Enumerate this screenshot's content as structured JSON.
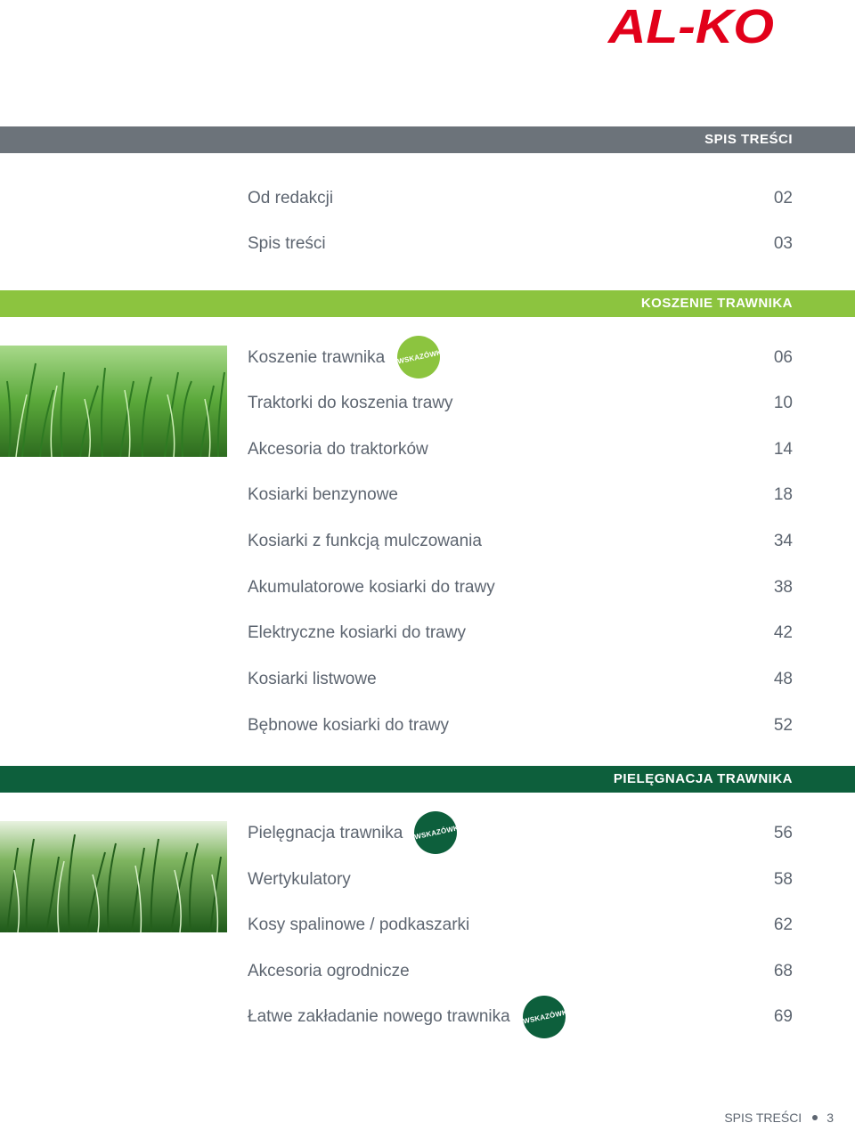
{
  "logo": {
    "text": "AL-KO",
    "color": "#e2001a"
  },
  "header": {
    "title": "SPIS TREŚCI"
  },
  "intro": [
    {
      "title": "Od redakcji",
      "page": "02"
    },
    {
      "title": "Spis treści",
      "page": "03"
    }
  ],
  "section1": {
    "title": "KOSZENIE TRAWNIKA",
    "color": "#8cc43f",
    "badge": "WSKAZÓWKI",
    "items": [
      {
        "title": "Koszenie trawnika",
        "page": "06"
      },
      {
        "title": "Traktorki do koszenia trawy",
        "page": "10"
      },
      {
        "title": "Akcesoria do traktorków",
        "page": "14"
      },
      {
        "title": "Kosiarki benzynowe",
        "page": "18"
      },
      {
        "title": "Kosiarki z funkcją mulczowania",
        "page": "34"
      },
      {
        "title": "Akumulatorowe kosiarki do trawy",
        "page": "38"
      },
      {
        "title": "Elektryczne kosiarki do trawy",
        "page": "42"
      },
      {
        "title": "Kosiarki listwowe",
        "page": "48"
      },
      {
        "title": "Bębnowe kosiarki do trawy",
        "page": "52"
      }
    ]
  },
  "section2": {
    "title": "PIELĘGNACJA TRAWNIKA",
    "color": "#0d5f3c",
    "badge": "WSKAZÓWKI",
    "badge2": "WSKAZÓWKI",
    "items": [
      {
        "title": "Pielęgnacja trawnika",
        "page": "56"
      },
      {
        "title": "Wertykulatory",
        "page": "58"
      },
      {
        "title": "Kosy spalinowe / podkaszarki",
        "page": "62"
      },
      {
        "title": "Akcesoria ogrodnicze",
        "page": "68"
      },
      {
        "title": "Łatwe zakładanie nowego trawnika",
        "page": "69"
      }
    ]
  },
  "footer": {
    "label": "SPIS TREŚCI",
    "page": "3"
  }
}
